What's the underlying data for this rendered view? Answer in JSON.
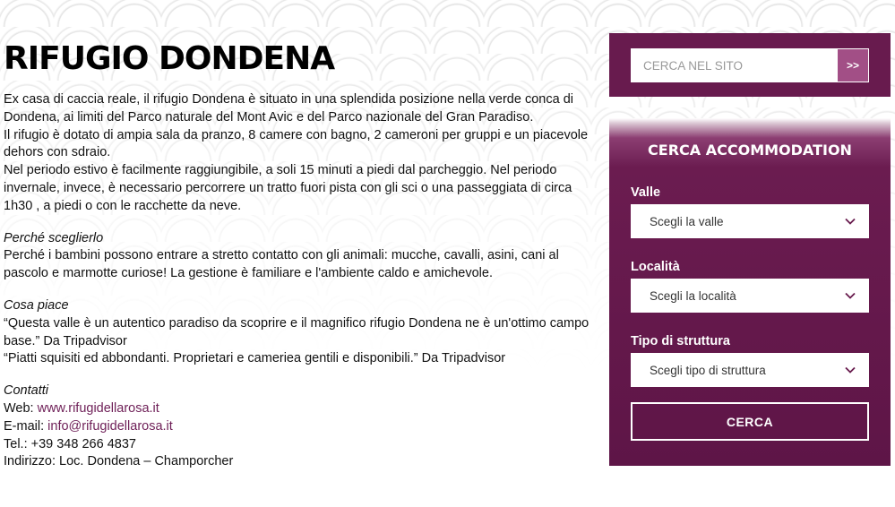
{
  "article": {
    "title": "RIFUGIO DONDENA",
    "intro": [
      "Ex casa di caccia reale, il rifugio Dondena è situato in una splendida posizione nella verde conca di Dondena, ai limiti del Parco naturale del Mont Avic e del Parco nazionale del Gran Paradiso.",
      "Il rifugio è dotato di ampia sala da pranzo, 8 camere con bagno, 2 cameroni per gruppi e un piacevole dehors con sdraio.",
      "Nel periodo estivo è facilmente raggiungibile, a soli 15  minuti a piedi dal parcheggio. Nel periodo invernale, invece,  è necessario percorrere un tratto fuori pista con gli sci o una passeggiata di circa 1h30 , a piedi o con le racchette da neve."
    ],
    "why": {
      "heading": "Perché sceglierlo",
      "text": "Perché i bambini possono entrare a stretto contatto con gli animali: mucche, cavalli, asini, cani al pascolo e marmotte curiose! La gestione è familiare e l'ambiente caldo e amichevole."
    },
    "likes": {
      "heading": "Cosa piace",
      "quote1": "“Questa valle è un autentico paradiso da scoprire e il magnifico rifugio Dondena ne è un'ottimo campo base.” Da Tripadvisor",
      "quote2": "“Piatti squisiti ed abbondanti. Proprietari e cameriea gentili e disponibili.” Da Tripadvisor"
    },
    "contacts": {
      "heading": "Contatti",
      "web_label": "Web: ",
      "web": "www.rifugidellarosa.it",
      "email_label": "E-mail: ",
      "email": "info@rifugidellarosa.it",
      "tel": "Tel.: +39 348 266 4837",
      "address": "Indirizzo: Loc. Dondena – Champorcher"
    }
  },
  "sidebar": {
    "search": {
      "placeholder": "CERCA NEL SITO",
      "button": ">>"
    },
    "accommodation": {
      "title": "CERCA ACCOMMODATION",
      "valle_label": "Valle",
      "valle_value": "Scegli la valle",
      "localita_label": "Località",
      "localita_value": "Scegli la località",
      "tipo_label": "Tipo di struttura",
      "tipo_value": "Scegli tipo di struttura",
      "submit": "CERCA"
    }
  },
  "colors": {
    "brand": "#681b4e",
    "link": "#6e1f57",
    "button_accent": "#a24f86"
  }
}
